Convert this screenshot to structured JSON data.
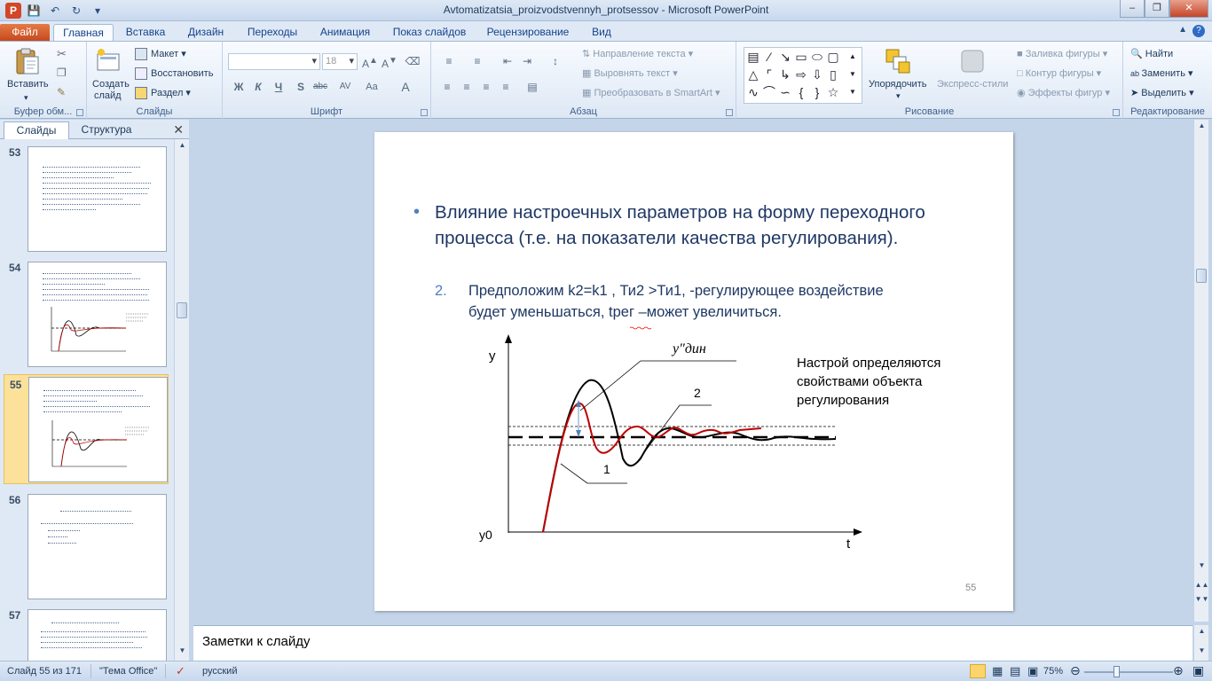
{
  "window": {
    "title": "Avtomatizatsia_proizvodstvennyh_protsessov  -  Microsoft PowerPoint"
  },
  "ribbon_tabs": [
    "Файл",
    "Главная",
    "Вставка",
    "Дизайн",
    "Переходы",
    "Анимация",
    "Показ слайдов",
    "Рецензирование",
    "Вид"
  ],
  "ribbon": {
    "clipboard": {
      "paste": "Вставить",
      "label": "Буфер обм..."
    },
    "slides": {
      "new_slide_1": "Создать",
      "new_slide_2": "слайд",
      "layout": "Макет",
      "reset": "Восстановить",
      "section": "Раздел",
      "label": "Слайды"
    },
    "font": {
      "size": "18",
      "label": "Шрифт"
    },
    "paragraph": {
      "direction": "Направление текста",
      "align": "Выровнять текст",
      "smartart": "Преобразовать в SmartArt",
      "label": "Абзац"
    },
    "drawing": {
      "arrange": "Упорядочить",
      "quick_styles": "Экспресс-стили",
      "fill": "Заливка фигуры",
      "outline": "Контур фигуры",
      "effects": "Эффекты фигур",
      "label": "Рисование"
    },
    "editing": {
      "find": "Найти",
      "replace": "Заменить",
      "select": "Выделить",
      "label": "Редактирование"
    }
  },
  "panel": {
    "tab_slides": "Слайды",
    "tab_outline": "Структура",
    "thumbnails": [
      {
        "num": "53"
      },
      {
        "num": "54"
      },
      {
        "num": "55"
      },
      {
        "num": "56"
      },
      {
        "num": "57"
      }
    ]
  },
  "slide": {
    "bullet_title": "Влияние настроечных параметров на форму переходного процесса (т.е. на показатели качества регулирования).",
    "item_number": "2.",
    "item_text_a": "Предположим k2=k1 , Ти2 >Ти1, -регулирующее воздействие",
    "item_text_b": "будет уменьшаться, tрег –может увеличиться.",
    "side_note": "Настрой определяются свойствами объекта регулирования",
    "axis_y": "y",
    "axis_y0": "y0",
    "axis_t": "t",
    "label_ydyn": "y\"дин",
    "label_curve1": "1",
    "label_curve2": "2",
    "page_number": "55"
  },
  "notes": {
    "placeholder": "Заметки к слайду"
  },
  "status": {
    "slide_info": "Слайд 55 из 171",
    "theme": "\"Тема Office\"",
    "language": "русский",
    "zoom": "75%"
  },
  "colors": {
    "accent_red": "#c00000",
    "accent_blue": "#4f81bd",
    "file_tab": "#d24726"
  }
}
